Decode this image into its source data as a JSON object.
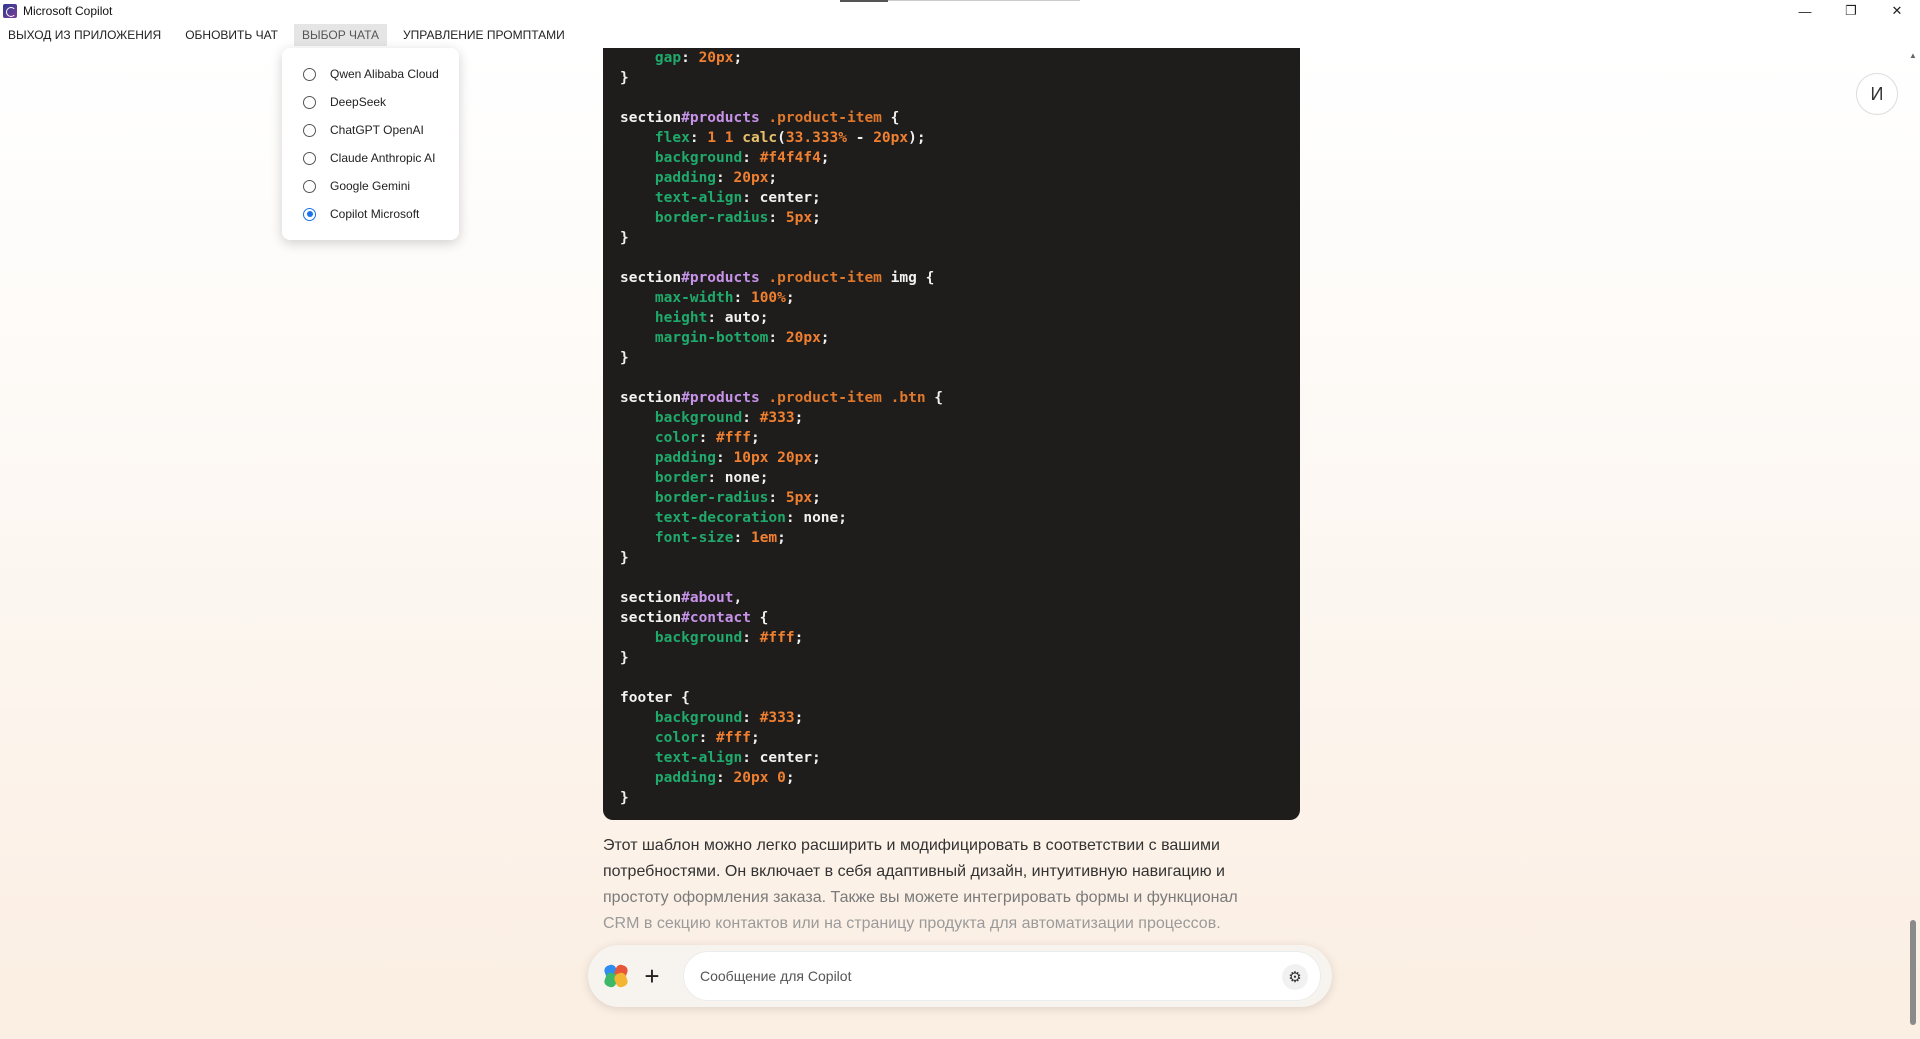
{
  "window": {
    "title": "Microsoft Copilot",
    "controls": {
      "minimize": "—",
      "restore": "❐",
      "close": "✕"
    }
  },
  "menubar": {
    "items": [
      {
        "label": "ВЫХОД ИЗ ПРИЛОЖЕНИЯ"
      },
      {
        "label": "ОБНОВИТЬ ЧАТ"
      },
      {
        "label": "ВЫБОР ЧАТА",
        "active": true
      },
      {
        "label": "УПРАВЛЕНИЕ ПРОМПТАМИ"
      }
    ]
  },
  "chat_dropdown": {
    "options": [
      {
        "label": "Qwen Alibaba Cloud",
        "selected": false
      },
      {
        "label": "DeepSeek",
        "selected": false
      },
      {
        "label": "ChatGPT OpenAI",
        "selected": false
      },
      {
        "label": "Claude Anthropic AI",
        "selected": false
      },
      {
        "label": "Google Gemini",
        "selected": false
      },
      {
        "label": "Copilot Microsoft",
        "selected": true
      }
    ]
  },
  "avatar": {
    "initial": "И"
  },
  "code_lines": [
    [
      [
        "prop",
        "    gap"
      ],
      [
        "val",
        ": "
      ],
      [
        "num",
        "20px"
      ],
      [
        "val",
        ";"
      ]
    ],
    [
      [
        "val",
        "}"
      ]
    ],
    [],
    [
      [
        "sel",
        "section"
      ],
      [
        "id",
        "#products"
      ],
      [
        "val",
        " "
      ],
      [
        "cls",
        ".product-item"
      ],
      [
        "val",
        " {"
      ]
    ],
    [
      [
        "prop",
        "    flex"
      ],
      [
        "val",
        ": "
      ],
      [
        "num",
        "1 1 "
      ],
      [
        "fn",
        "calc"
      ],
      [
        "val",
        "("
      ],
      [
        "num",
        "33.333%"
      ],
      [
        "val",
        " - "
      ],
      [
        "num",
        "20px"
      ],
      [
        "val",
        ");"
      ]
    ],
    [
      [
        "prop",
        "    background"
      ],
      [
        "val",
        ": "
      ],
      [
        "hex",
        "#f4f4f4"
      ],
      [
        "val",
        ";"
      ]
    ],
    [
      [
        "prop",
        "    padding"
      ],
      [
        "val",
        ": "
      ],
      [
        "num",
        "20px"
      ],
      [
        "val",
        ";"
      ]
    ],
    [
      [
        "prop",
        "    text-align"
      ],
      [
        "val",
        ": center;"
      ]
    ],
    [
      [
        "prop",
        "    border-radius"
      ],
      [
        "val",
        ": "
      ],
      [
        "num",
        "5px"
      ],
      [
        "val",
        ";"
      ]
    ],
    [
      [
        "val",
        "}"
      ]
    ],
    [],
    [
      [
        "sel",
        "section"
      ],
      [
        "id",
        "#products"
      ],
      [
        "val",
        " "
      ],
      [
        "cls",
        ".product-item"
      ],
      [
        "val",
        " img {"
      ]
    ],
    [
      [
        "prop",
        "    max-width"
      ],
      [
        "val",
        ": "
      ],
      [
        "num",
        "100%"
      ],
      [
        "val",
        ";"
      ]
    ],
    [
      [
        "prop",
        "    height"
      ],
      [
        "val",
        ": auto;"
      ]
    ],
    [
      [
        "prop",
        "    margin-bottom"
      ],
      [
        "val",
        ": "
      ],
      [
        "num",
        "20px"
      ],
      [
        "val",
        ";"
      ]
    ],
    [
      [
        "val",
        "}"
      ]
    ],
    [],
    [
      [
        "sel",
        "section"
      ],
      [
        "id",
        "#products"
      ],
      [
        "val",
        " "
      ],
      [
        "cls",
        ".product-item"
      ],
      [
        "val",
        " "
      ],
      [
        "cls",
        ".btn"
      ],
      [
        "val",
        " {"
      ]
    ],
    [
      [
        "prop",
        "    background"
      ],
      [
        "val",
        ": "
      ],
      [
        "hex",
        "#333"
      ],
      [
        "val",
        ";"
      ]
    ],
    [
      [
        "prop",
        "    color"
      ],
      [
        "val",
        ": "
      ],
      [
        "hex",
        "#fff"
      ],
      [
        "val",
        ";"
      ]
    ],
    [
      [
        "prop",
        "    padding"
      ],
      [
        "val",
        ": "
      ],
      [
        "num",
        "10px 20px"
      ],
      [
        "val",
        ";"
      ]
    ],
    [
      [
        "prop",
        "    border"
      ],
      [
        "val",
        ": none;"
      ]
    ],
    [
      [
        "prop",
        "    border-radius"
      ],
      [
        "val",
        ": "
      ],
      [
        "num",
        "5px"
      ],
      [
        "val",
        ";"
      ]
    ],
    [
      [
        "prop",
        "    text-decoration"
      ],
      [
        "val",
        ": none;"
      ]
    ],
    [
      [
        "prop",
        "    font-size"
      ],
      [
        "val",
        ": "
      ],
      [
        "num",
        "1em"
      ],
      [
        "val",
        ";"
      ]
    ],
    [
      [
        "val",
        "}"
      ]
    ],
    [],
    [
      [
        "sel",
        "section"
      ],
      [
        "id",
        "#about"
      ],
      [
        "val",
        ","
      ]
    ],
    [
      [
        "sel",
        "section"
      ],
      [
        "id",
        "#contact"
      ],
      [
        "val",
        " {"
      ]
    ],
    [
      [
        "prop",
        "    background"
      ],
      [
        "val",
        ": "
      ],
      [
        "hex",
        "#fff"
      ],
      [
        "val",
        ";"
      ]
    ],
    [
      [
        "val",
        "}"
      ]
    ],
    [],
    [
      [
        "sel",
        "footer"
      ],
      [
        "val",
        " {"
      ]
    ],
    [
      [
        "prop",
        "    background"
      ],
      [
        "val",
        ": "
      ],
      [
        "hex",
        "#333"
      ],
      [
        "val",
        ";"
      ]
    ],
    [
      [
        "prop",
        "    color"
      ],
      [
        "val",
        ": "
      ],
      [
        "hex",
        "#fff"
      ],
      [
        "val",
        ";"
      ]
    ],
    [
      [
        "prop",
        "    text-align"
      ],
      [
        "val",
        ": center;"
      ]
    ],
    [
      [
        "prop",
        "    padding"
      ],
      [
        "val",
        ": "
      ],
      [
        "num",
        "20px 0"
      ],
      [
        "val",
        ";"
      ]
    ],
    [
      [
        "val",
        "}"
      ]
    ]
  ],
  "response": {
    "line1": "Этот шаблон можно легко расширить и модифицировать в соответствии с вашими",
    "line2": "потребностями. Он включает в себя адаптивный дизайн, интуитивную навигацию и",
    "line3": "простоту оформления заказа. Также вы можете интегрировать формы и функционал",
    "line4": "CRM в секцию контактов или на страницу продукта для автоматизации процессов."
  },
  "composer": {
    "placeholder": "Сообщение для Copilot",
    "plus_label": "+",
    "settings_icon": "⚙"
  },
  "colors": {
    "code_bg": "#1f1d1c",
    "radio_selected": "#1a73e8"
  }
}
